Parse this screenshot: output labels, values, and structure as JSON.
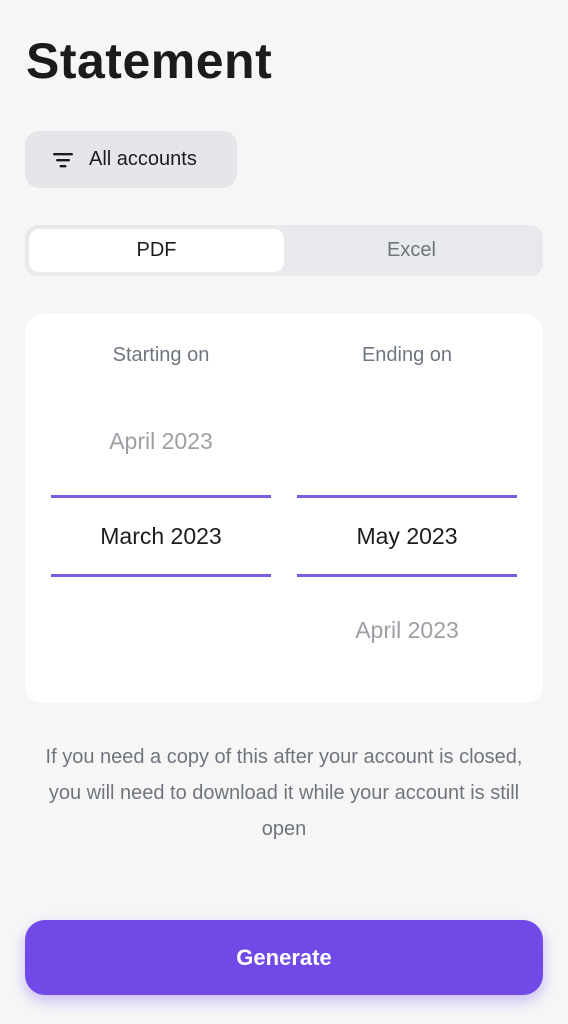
{
  "page": {
    "title": "Statement"
  },
  "filter": {
    "label": "All accounts",
    "icon": "filter-lines-icon"
  },
  "format_tabs": [
    {
      "label": "PDF",
      "selected": true
    },
    {
      "label": "Excel",
      "selected": false
    }
  ],
  "date_picker": {
    "start": {
      "heading": "Starting on",
      "above": "April 2023",
      "selected": "March 2023",
      "below": ""
    },
    "end": {
      "heading": "Ending on",
      "above": "",
      "selected": "May 2023",
      "below": "April 2023"
    }
  },
  "note": "If you need a copy of this after your account is closed, you will need to download it while your account is still open",
  "actions": {
    "generate_label": "Generate"
  },
  "colors": {
    "accent": "#7049e6",
    "selection_line": "#7c5ce0",
    "background": "#f6f6f7"
  }
}
